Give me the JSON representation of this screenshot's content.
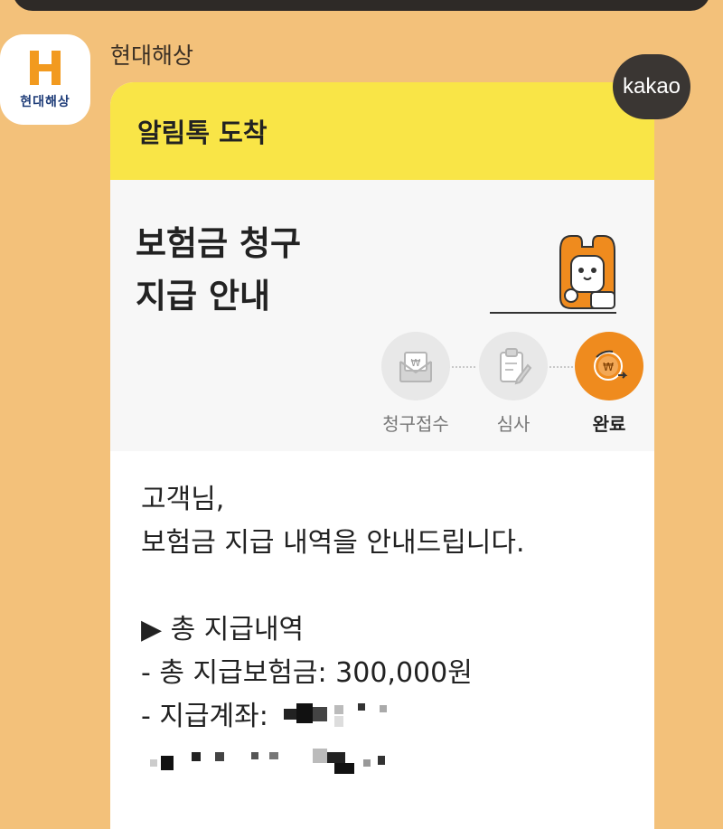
{
  "app": {
    "sender_name": "현대해상",
    "profile_logo_text": "현대해상",
    "badge_text": "kakao"
  },
  "message": {
    "header_title": "알림톡 도착",
    "hero_title_line1": "보험금 청구",
    "hero_title_line2": "지급 안내",
    "steps": [
      {
        "label": "청구접수",
        "state": "done"
      },
      {
        "label": "심사",
        "state": "done"
      },
      {
        "label": "완료",
        "state": "active"
      }
    ],
    "body": {
      "greeting": "고객님,",
      "intro": "보험금 지급 내역을 안내드립니다.",
      "section_title": "▶ 총 지급내역",
      "total_paid": "- 총 지급보험금: 300,000원",
      "account_label": "- 지급계좌:"
    }
  },
  "colors": {
    "background": "#f3c17a",
    "header_yellow": "#f9e547",
    "step_active": "#ef8b1e",
    "brand_orange": "#f29a1f",
    "brand_navy": "#1e3c78"
  },
  "icons": {
    "profile": "hyundai-h-logo-icon",
    "step1": "envelope-won-icon",
    "step2": "clipboard-pen-icon",
    "step3": "coin-cycle-icon",
    "mascot": "mascot-character-icon"
  }
}
